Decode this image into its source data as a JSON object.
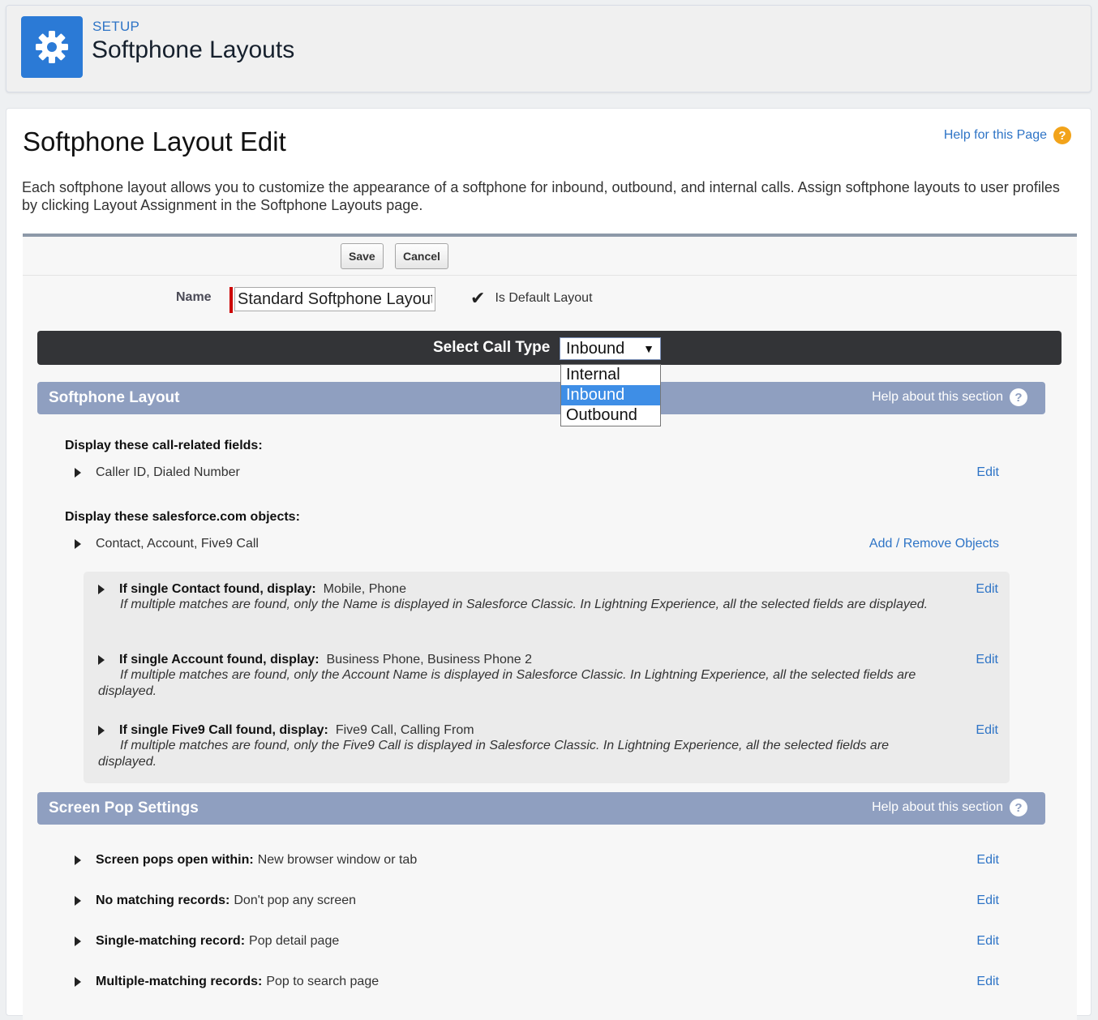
{
  "header": {
    "eyebrow": "SETUP",
    "title": "Softphone Layouts"
  },
  "page": {
    "title": "Softphone Layout Edit",
    "help_link": "Help for this Page",
    "description": "Each softphone layout allows you to customize the appearance of a softphone for inbound, outbound, and internal calls. Assign softphone layouts to user profiles by clicking Layout Assignment in the Softphone Layouts page."
  },
  "buttons": {
    "save": "Save",
    "cancel": "Cancel"
  },
  "form": {
    "name_label": "Name",
    "name_value": "Standard Softphone Layout",
    "is_default_label": "Is Default Layout"
  },
  "call_type": {
    "label": "Select Call Type",
    "selected": "Inbound",
    "options": [
      "Internal",
      "Inbound",
      "Outbound"
    ]
  },
  "softphone_section": {
    "title": "Softphone Layout",
    "help": "Help about this section",
    "fields_heading": "Display these call-related fields:",
    "fields_value": "Caller ID, Dialed Number",
    "fields_edit": "Edit",
    "objects_heading": "Display these salesforce.com objects:",
    "objects_value": "Contact, Account, Five9 Call",
    "objects_link": "Add / Remove Objects",
    "objects": [
      {
        "label": "If single Contact found, display:",
        "value": "Mobile, Phone",
        "note": "If multiple matches are found, only the Name is displayed in Salesforce Classic. In Lightning Experience, all the selected fields are displayed.",
        "edit": "Edit"
      },
      {
        "label": "If single Account found, display:",
        "value": "Business Phone, Business Phone 2",
        "note": "If multiple matches are found, only the Account Name is displayed in Salesforce Classic. In Lightning Experience, all the selected fields are displayed.",
        "edit": "Edit"
      },
      {
        "label": "If single Five9 Call found, display:",
        "value": "Five9 Call, Calling From",
        "note": "If multiple matches are found, only the Five9 Call is displayed in Salesforce Classic. In Lightning Experience, all the selected fields are displayed.",
        "edit": "Edit"
      }
    ]
  },
  "screen_pop_section": {
    "title": "Screen Pop Settings",
    "help": "Help about this section",
    "rows": [
      {
        "label": "Screen pops open within:",
        "value": "New browser window or tab",
        "edit": "Edit"
      },
      {
        "label": "No matching records:",
        "value": "Don't pop any screen",
        "edit": "Edit"
      },
      {
        "label": "Single-matching record:",
        "value": "Pop detail page",
        "edit": "Edit"
      },
      {
        "label": "Multiple-matching records:",
        "value": "Pop to search page",
        "edit": "Edit"
      }
    ]
  },
  "colors": {
    "accent": "#2b7ad6",
    "section_bar": "#8f9fc0",
    "call_bar": "#333437",
    "link": "#2e74c6"
  }
}
